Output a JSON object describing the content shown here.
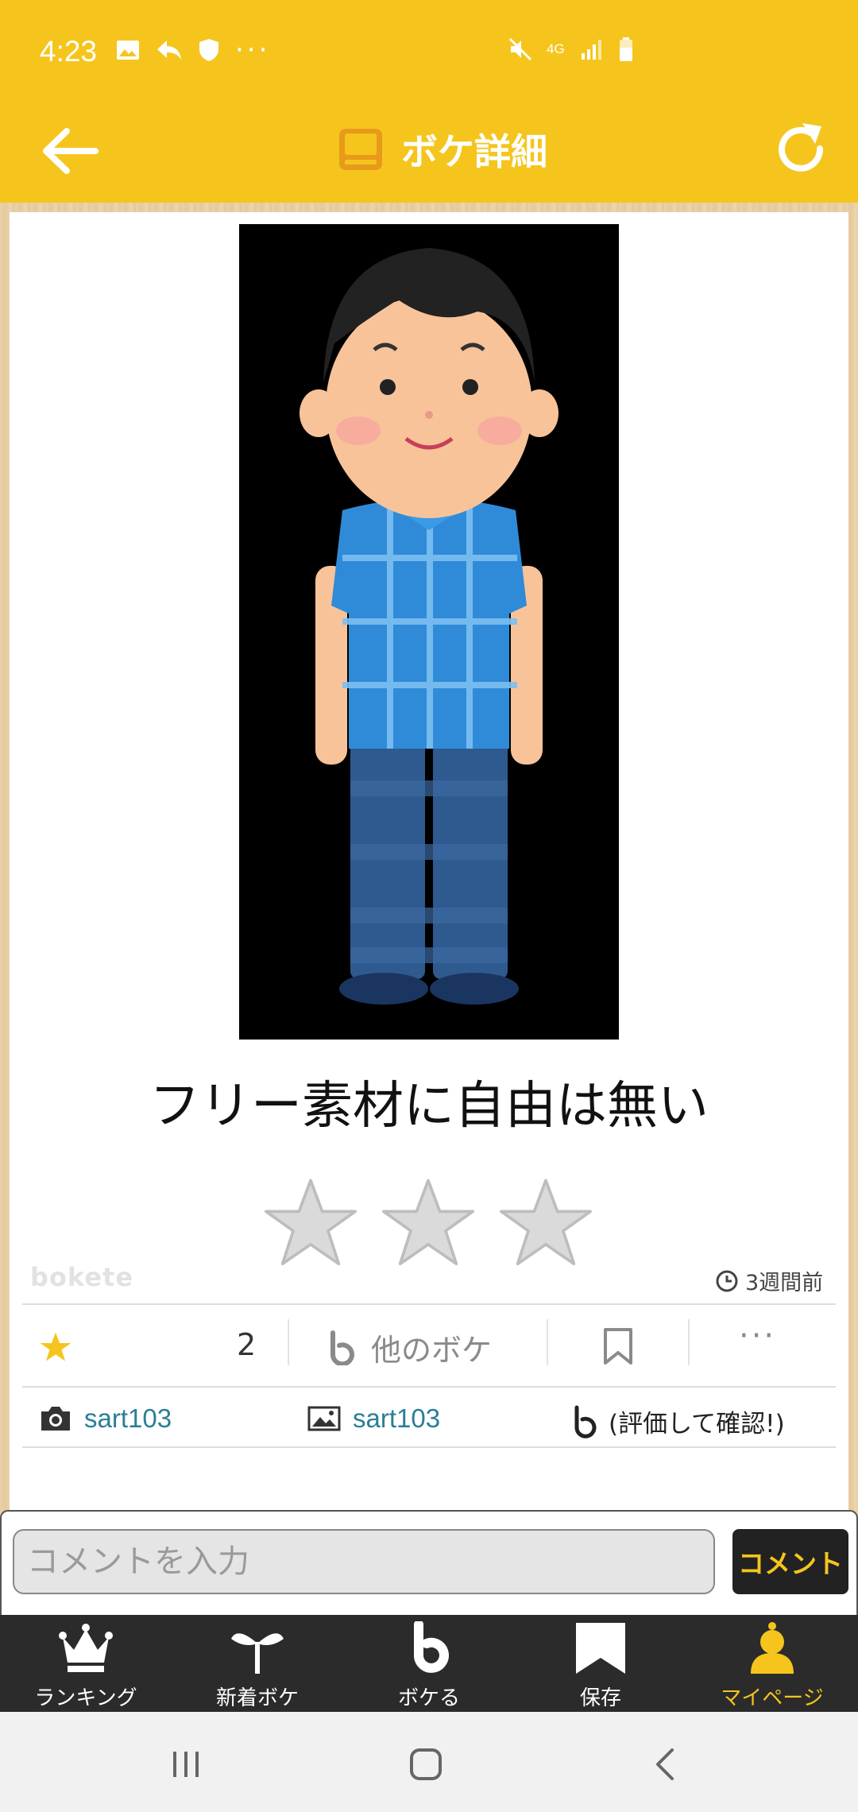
{
  "status_bar": {
    "time": "4:23",
    "network": "4G",
    "icons": [
      "image-icon",
      "reply-icon",
      "shield-icon",
      "more-dots-icon",
      "mute-icon",
      "network-4g-icon",
      "signal-icon",
      "battery-icon"
    ]
  },
  "header": {
    "title": "ボケ詳細",
    "back_icon": "arrow-left-icon",
    "refresh_icon": "refresh-icon"
  },
  "boke": {
    "text": "フリー素材に自由は無い",
    "watermark": "bokete",
    "time_ago": "3週間前",
    "rating_stars": 3
  },
  "actions": {
    "favorite_count": "2",
    "other_bokes_label": "他のボケ",
    "more_label": "···"
  },
  "credits": {
    "photo_author": "sart103",
    "image_author": "sart103",
    "boke_author": "(評価して確認!)"
  },
  "comment": {
    "placeholder": "コメントを入力",
    "submit_label": "コメント"
  },
  "bottom_nav": {
    "items": [
      {
        "label": "ランキング",
        "icon": "crown-icon"
      },
      {
        "label": "新着ボケ",
        "icon": "sprout-icon"
      },
      {
        "label": "ボケる",
        "icon": "bokete-b-icon"
      },
      {
        "label": "保存",
        "icon": "bookmark-icon"
      },
      {
        "label": "マイページ",
        "icon": "user-icon",
        "active": true
      }
    ]
  },
  "colors": {
    "accent": "#f5c51d",
    "nav_bg": "#2b2b2b",
    "link": "#2a7e96"
  }
}
